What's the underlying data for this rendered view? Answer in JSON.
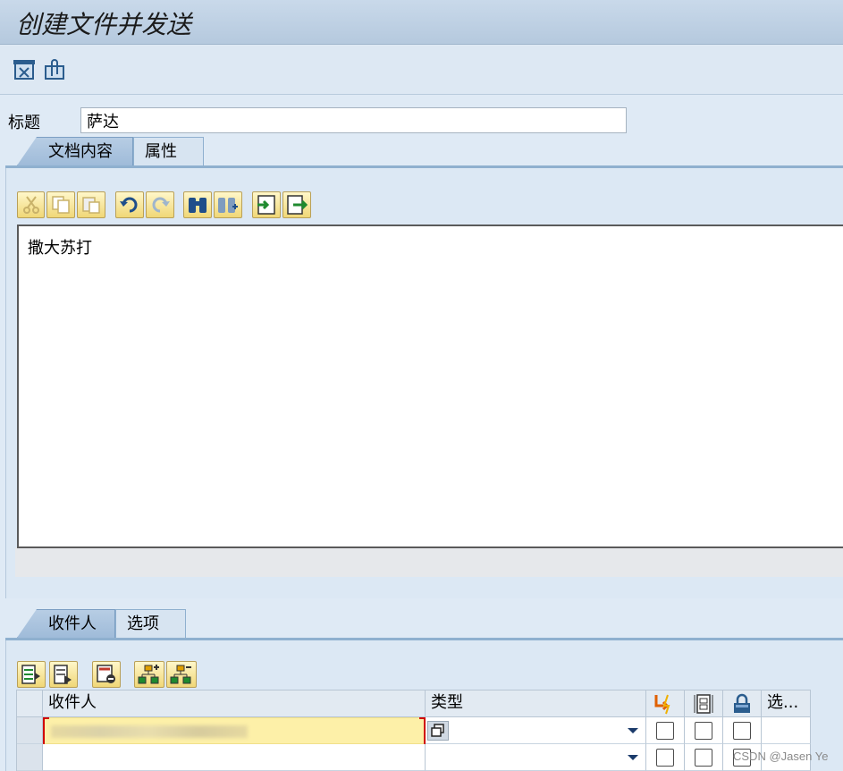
{
  "window": {
    "title": "创建文件并发送"
  },
  "toolbar": {
    "icons": [
      "document-properties-icon",
      "attachment-icon"
    ]
  },
  "subject": {
    "label": "标题",
    "value": "萨达"
  },
  "doc_tabs": [
    {
      "label": "文档内容",
      "active": true
    },
    {
      "label": "属性",
      "active": false
    }
  ],
  "editor": {
    "buttons": [
      "cut-icon",
      "copy-icon",
      "paste-icon",
      "undo-icon",
      "redo-icon",
      "find-icon",
      "find-next-icon",
      "import-icon",
      "export-icon"
    ],
    "content": "撒大苏打"
  },
  "recipient_tabs": [
    {
      "label": "收件人",
      "active": true
    },
    {
      "label": "选项",
      "active": false
    }
  ],
  "recipients": {
    "toolbar_icons": [
      "insert-row-icon",
      "append-row-icon",
      "delete-row-icon",
      "add-distribution-list-icon",
      "expand-list-icon"
    ],
    "headers": {
      "recipient": "收件人",
      "type": "类型",
      "express_icon": "express-icon",
      "copy_icon": "copy-icon",
      "blind_icon": "lock-icon",
      "options": "选..."
    },
    "rows": [
      {
        "recipient": "",
        "type": "",
        "selected": true
      },
      {
        "recipient": "",
        "type": "",
        "selected": false
      }
    ]
  },
  "watermark": "CSDN @Jasen Ye"
}
